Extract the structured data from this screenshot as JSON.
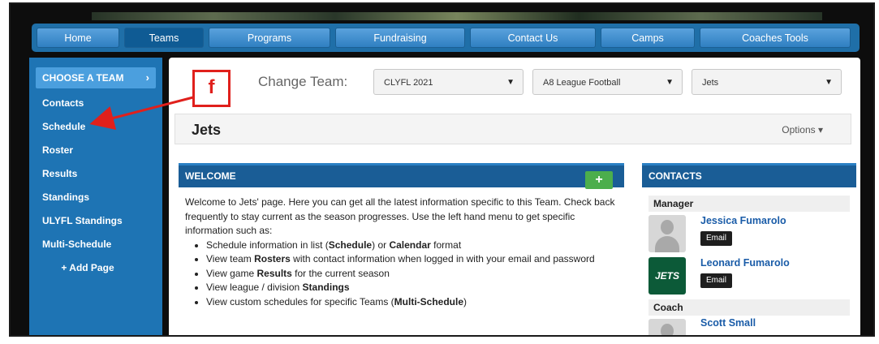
{
  "nav": {
    "items": [
      {
        "label": "Home",
        "active": false
      },
      {
        "label": "Teams",
        "active": true
      },
      {
        "label": "Programs",
        "active": false
      },
      {
        "label": "Fundraising",
        "active": false
      },
      {
        "label": "Contact Us",
        "active": false
      },
      {
        "label": "Camps",
        "active": false
      },
      {
        "label": "Coaches Tools",
        "active": false
      }
    ]
  },
  "sidebar": {
    "choose_team": "CHOOSE A TEAM",
    "choose_chevron": "›",
    "items": [
      "Contacts",
      "Schedule",
      "Roster",
      "Results",
      "Standings",
      "ULYFL Standings",
      "Multi-Schedule"
    ],
    "add_page": "+ Add Page"
  },
  "change_team": {
    "label": "Change Team:",
    "selects": [
      "CLYFL 2021",
      "A8 League Football",
      "Jets"
    ]
  },
  "team": {
    "title": "Jets",
    "options_label": "Options ▾"
  },
  "welcome": {
    "title": "WELCOME",
    "plus": "+",
    "intro": "Welcome to Jets' page. Here you can get all the latest information specific to this Team. Check back frequently to stay current as the season progresses. Use the left hand menu to get specific information such as:",
    "bullets": [
      [
        "Schedule information in list (",
        "Schedule",
        ") or ",
        "Calendar",
        " format"
      ],
      [
        "View team ",
        "Rosters",
        " with contact information when logged in with your email and password",
        "",
        ""
      ],
      [
        "View game ",
        "Results",
        " for the current season",
        "",
        ""
      ],
      [
        "View league / division ",
        "Standings",
        "",
        "",
        ""
      ],
      [
        "View custom schedules for specific Teams (",
        "Multi-Schedule",
        ")",
        "",
        ""
      ]
    ]
  },
  "contacts": {
    "title": "CONTACTS",
    "manager_label": "Manager",
    "managers": [
      {
        "name": "Jessica Fumarolo",
        "email_label": "Email"
      },
      {
        "name": "Leonard Fumarolo",
        "email_label": "Email"
      }
    ],
    "coach_label": "Coach",
    "coaches": [
      {
        "name": "Scott Small"
      }
    ],
    "logo_text": "JETS"
  },
  "annotation": {
    "letter": "f",
    "color": "#e0201c"
  },
  "colors": {
    "nav_bg": "#1f6fa8",
    "sidebar_bg": "#1e74b4",
    "panel_head": "#1a5d96",
    "link": "#1a5ca8",
    "plus_green": "#4cae4c"
  }
}
